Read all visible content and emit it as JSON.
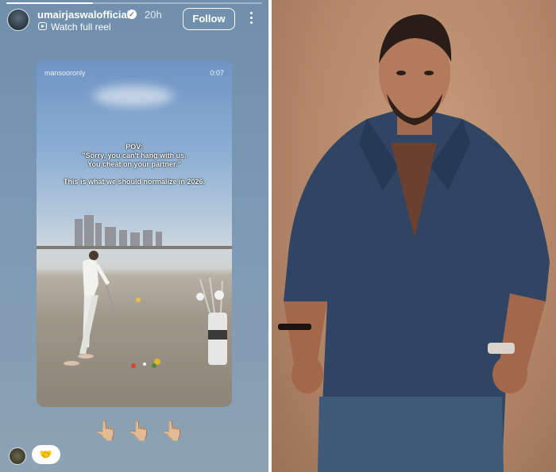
{
  "story": {
    "progress": 0.34,
    "username": "umairjaswalofficial",
    "verified_icon": "verified-badge-icon",
    "time": "20h",
    "subtitle": "Watch full reel",
    "follow_label": "Follow",
    "more_icon": "more-vertical-icon"
  },
  "reel": {
    "handle": "mansooronly",
    "duration": "0:07",
    "caption_line1": "POV:",
    "caption_line2": "\"Sorry, you can't hang with us.",
    "caption_line3": "You cheat on your partner.\"",
    "caption_line4": "This is what we should normalize in 2026."
  },
  "footer": {
    "emojis": "👆🏼👆🏼👆🏼",
    "reaction": "🤝"
  },
  "colors": {
    "accent": "#ffffff",
    "backdrop": "#b3876a",
    "shirt": "#2f4563"
  }
}
